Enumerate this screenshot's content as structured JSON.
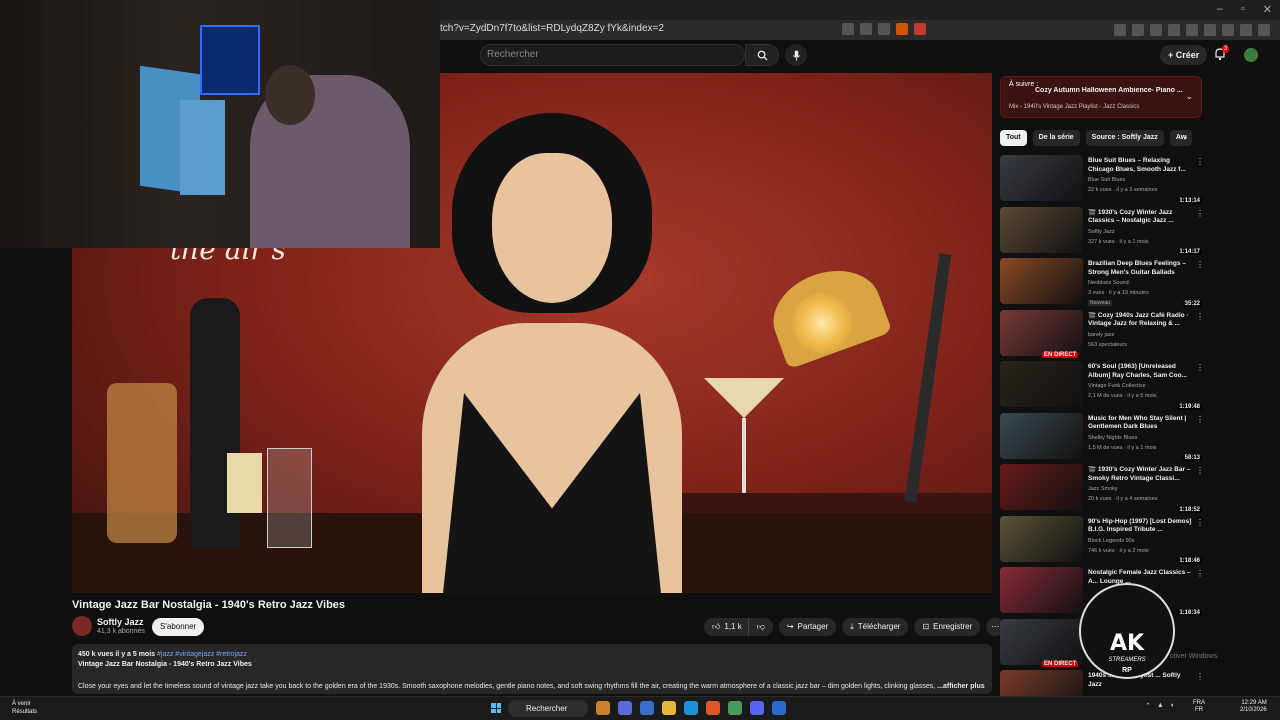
{
  "browser": {
    "url": "tch?v=ZydDn7f7to&list=RDLydqZ8Zy fYk&index=2"
  },
  "header": {
    "search_placeholder": "Rechercher",
    "create_label": "Créer",
    "notif_count": "3"
  },
  "video": {
    "overlay_text": "the air's",
    "title": "Vintage Jazz Bar Nostalgia - 1940's Retro Jazz Vibes",
    "channel": "Softly Jazz",
    "subs": "41,3 k abonnés",
    "subscribe": "S'abonner",
    "likes": "1,1 k",
    "share": "Partager",
    "download": "Télécharger",
    "save": "Enregistrer"
  },
  "description": {
    "meta": "450 k vues  il y a 5 mois",
    "tags": "#jazz #vintagejazz #retrojazz",
    "title": "Vintage Jazz Bar Nostalgia - 1940's Retro Jazz Vibes",
    "body": "Close your eyes and let the timeless sound of vintage jazz take you back to the golden era of the 1930s. Smooth saxophone melodies, gentle piano notes, and soft swing rhythms fill the air, creating the warm atmosphere of a classic jazz bar – dim golden lights, clinking glasses,",
    "more": "...afficher plus"
  },
  "upnext": {
    "label": "À suivre :",
    "title": "Cozy Autumn Halloween Ambience- Piano ...",
    "sub": "Mix - 1940's Vintage Jazz Playlist - Jazz Classics"
  },
  "chips": [
    "Tout",
    "De la série",
    "Source : Softly Jazz",
    "Aw"
  ],
  "recommendations": [
    {
      "title": "Blue Suit Blues – Relaxing Chicago Blues, Smooth Jazz f...",
      "channel": "Blue Suit Blues",
      "meta": "22 k vues · il y a 3 semaines",
      "duration": "1:13:14",
      "live": "",
      "badge": "",
      "color": "#3a3a44"
    },
    {
      "title": "🎬 1930's Cozy Winter Jazz Classics – Nostalgic Jazz ...",
      "channel": "Softly Jazz",
      "meta": "327 k vues · il y a 1 mois",
      "duration": "1:14:17",
      "live": "",
      "badge": "",
      "color": "#5a4a38"
    },
    {
      "title": "Brazilian Deep Blues Feelings – Strong Men's Guitar Ballads",
      "channel": "Neoblues Sound",
      "meta": "3 vues · il y a 19 minutes",
      "duration": "35:22",
      "live": "",
      "badge": "Nouveau",
      "color": "#8a4a22"
    },
    {
      "title": "🎬 Cozy 1940s Jazz Café Radio · Vintage Jazz for Relaxing & ...",
      "channel": "barely jazz",
      "meta": "563 spectateurs",
      "duration": "",
      "live": "EN DIRECT",
      "badge": "",
      "color": "#7a3a3a"
    },
    {
      "title": "60's Soul (1963) [Unreleased Album] Ray Charles, Sam Coo...",
      "channel": "Vintage Funk Collective",
      "meta": "2,1 M de vues · il y a 5 mois",
      "duration": "1:19:48",
      "live": "",
      "badge": "",
      "color": "#2a2418"
    },
    {
      "title": "Music for Men Who Stay Silent | Gentlemen Dark Blues",
      "channel": "Shelby Nights Blues",
      "meta": "1,5 M de vues · il y a 1 mois",
      "duration": "58:13",
      "live": "",
      "badge": "",
      "color": "#3a4a52"
    },
    {
      "title": "🎬 1930's Cozy Winter Jazz Bar – Smoky Retro Vintage Classi...",
      "channel": "Jazz Smoky",
      "meta": "20 k vues · il y a 4 semaines",
      "duration": "1:18:52",
      "live": "",
      "badge": "",
      "color": "#6a1a1a"
    },
    {
      "title": "90's Hip-Hop (1997) [Lost Demos] B.I.G. Inspired Tribute ...",
      "channel": "Block Legends 90s",
      "meta": "746 k vues · il y a 2 mois",
      "duration": "1:18:46",
      "live": "",
      "badge": "",
      "color": "#5a5238"
    },
    {
      "title": "Nostalgic Female Jazz Classics – A... Lounge ...",
      "channel": "",
      "meta": "",
      "duration": "1:16:34",
      "live": "",
      "badge": "",
      "color": "#8a2a3a"
    },
    {
      "title": "",
      "channel": "",
      "meta": "",
      "duration": "",
      "live": "EN DIRECT",
      "badge": "",
      "color": "#3a3a44"
    },
    {
      "title": "1940s ... Jazz Playlist ... Softly Jazz",
      "channel": "",
      "meta": "",
      "duration": "",
      "live": "",
      "badge": "",
      "color": "#7a3a2a"
    }
  ],
  "overlay_logo": {
    "text": "AK",
    "sub": "STREAMERS",
    "rp": "RP",
    "activate": "ctiver Windows."
  },
  "taskbar": {
    "weather_label": "À venir",
    "weather_sub": "Résultats",
    "search": "Rechercher",
    "lang1": "FRA",
    "lang2": "FR",
    "time": "12:29 AM",
    "date": "2/10/2026"
  }
}
